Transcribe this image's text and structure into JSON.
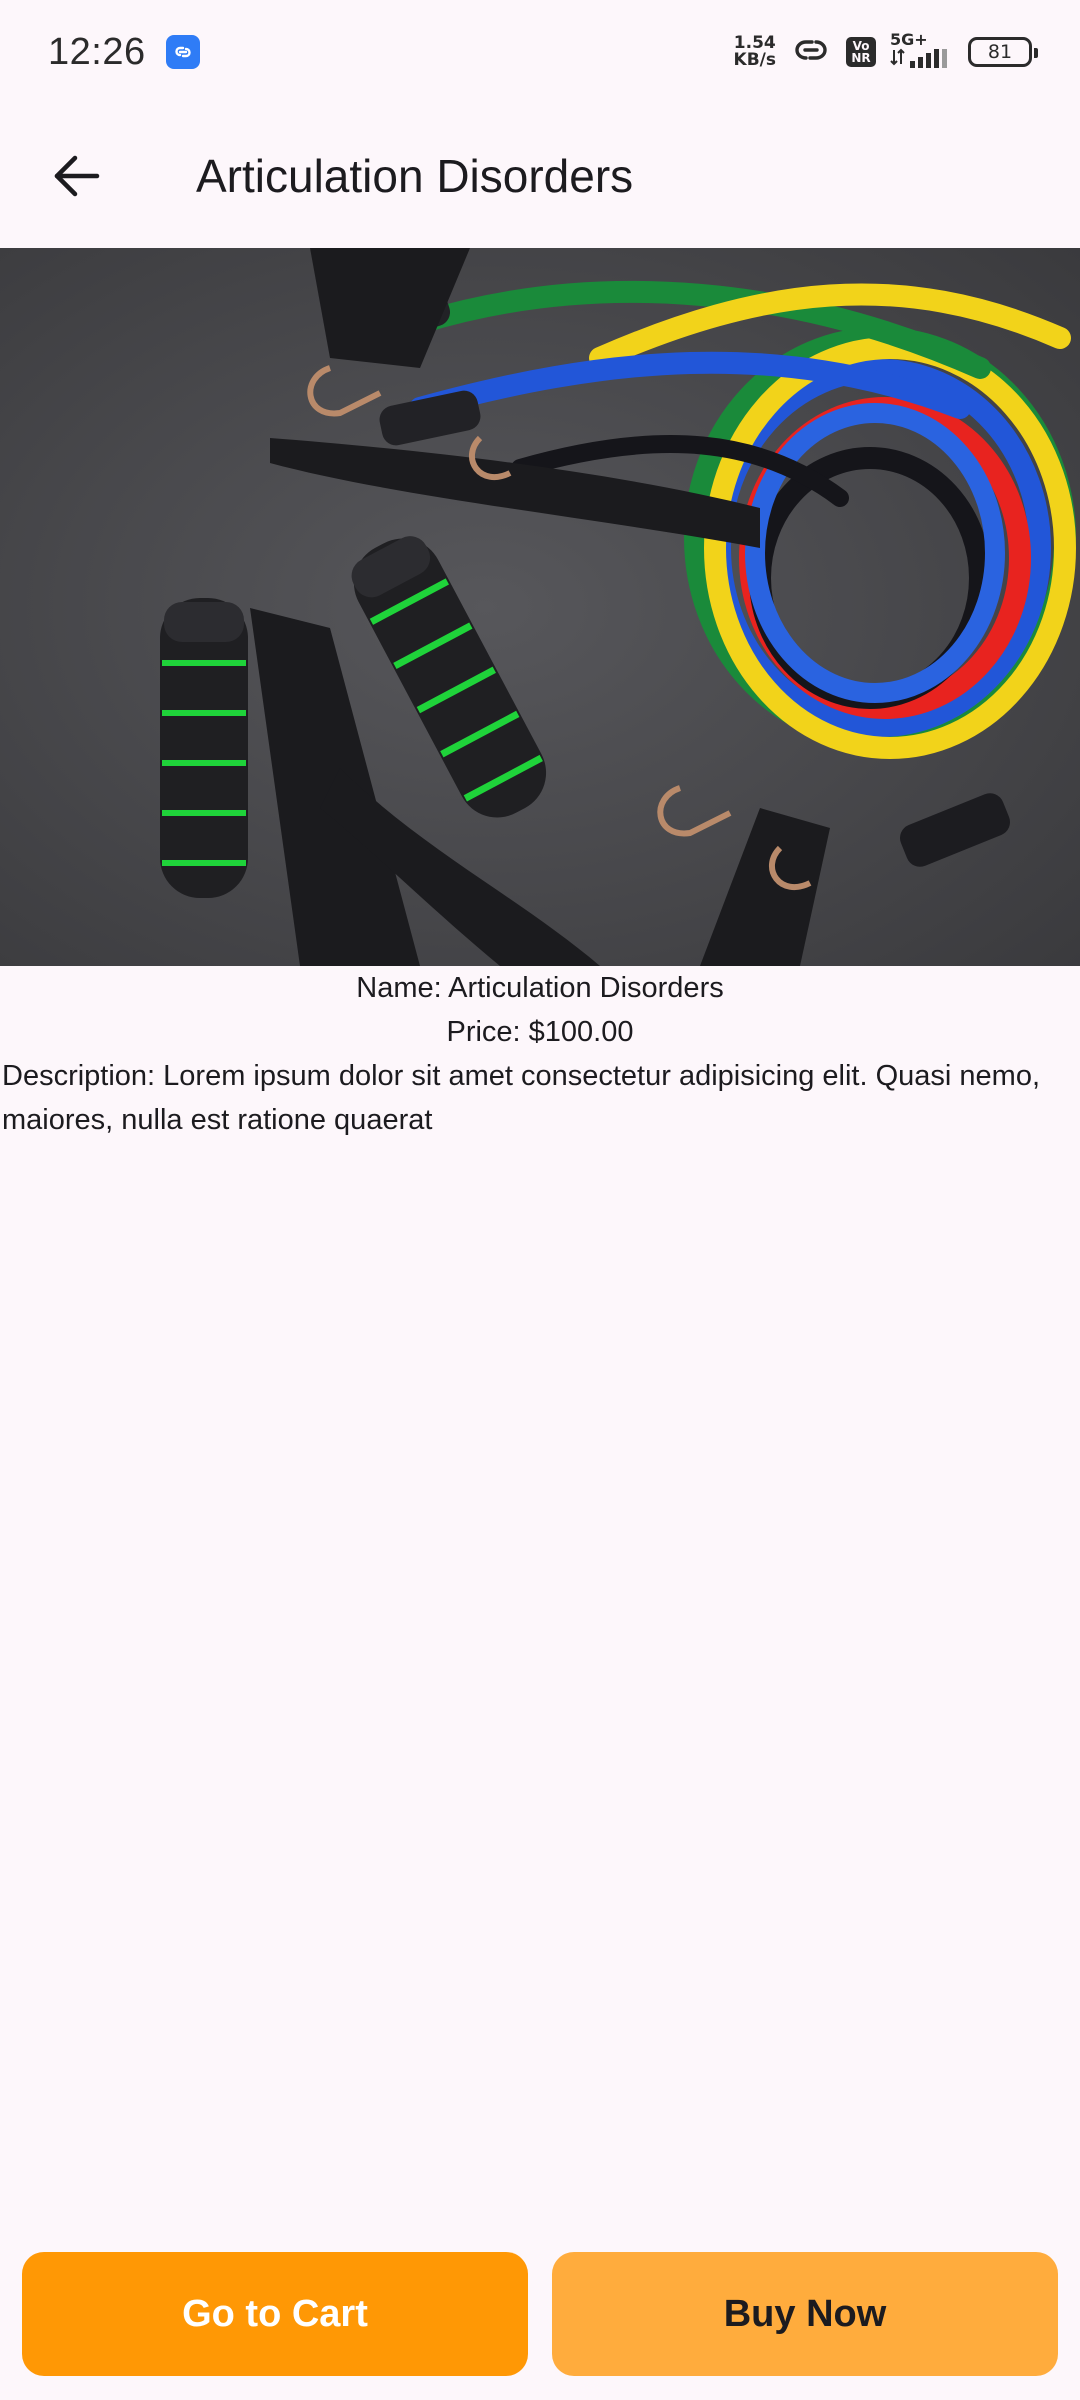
{
  "status_bar": {
    "time": "12:26",
    "net_speed_value": "1.54",
    "net_speed_unit": "KB/s",
    "volte_top": "Vo",
    "volte_bottom": "NR",
    "network_type": "5G+",
    "battery": "81"
  },
  "app_bar": {
    "title": "Articulation Disorders"
  },
  "product": {
    "name_line": "Name: Articulation Disorders",
    "price_line": "Price: $100.00",
    "description_line": "Description: Lorem ipsum dolor sit amet consectetur adipisicing elit. Quasi nemo, maiores, nulla est ratione quaerat"
  },
  "actions": {
    "go_to_cart": "Go to Cart",
    "buy_now": "Buy Now"
  },
  "colors": {
    "accent_primary": "#ff9805",
    "accent_secondary": "#ffac3d",
    "background": "#fdf7fb"
  },
  "icons": {
    "back": "arrow-left-icon",
    "status_app": "link-app-icon",
    "hotspot": "link-icon",
    "signal": "signal-icon",
    "battery": "battery-icon"
  }
}
